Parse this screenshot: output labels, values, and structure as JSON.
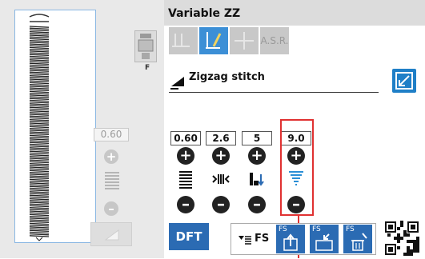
{
  "left_panel": {
    "presser_foot_letter": "F",
    "value": "0.60"
  },
  "header": {
    "title": "Variable ZZ"
  },
  "mode_tabs": [
    {
      "icon": "twin-needle-icon"
    },
    {
      "icon": "needle-position-icon"
    },
    {
      "icon": "cross-cursor-icon"
    },
    {
      "label": "A.S.R."
    }
  ],
  "stitch": {
    "name": "Zigzag stitch",
    "icon": "stitch-type-icon"
  },
  "settings": [
    {
      "value": "0.60",
      "icon": "stitch-density-icon"
    },
    {
      "value": "2.6",
      "icon": "zigzag-width-icon"
    },
    {
      "value": "5",
      "icon": "needle-stop-position-icon"
    },
    {
      "value": "9.0",
      "icon": "taper-density-icon"
    }
  ],
  "footer": {
    "dft_label": "DFT",
    "fs_label": "FS",
    "fs_buttons": [
      {
        "label": "FS"
      },
      {
        "label": "FS"
      },
      {
        "label": "FS"
      }
    ]
  },
  "colors": {
    "accent_blue": "#2b6bb3",
    "highlight_red": "#e03131"
  }
}
